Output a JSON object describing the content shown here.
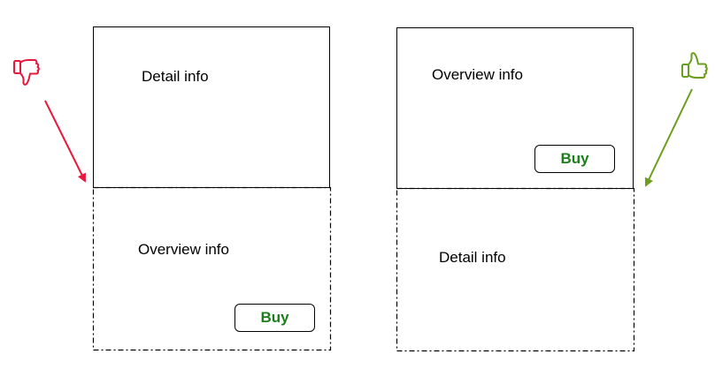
{
  "left_layout": {
    "top_label": "Detail info",
    "bottom_label": "Overview info",
    "buy_label": "Buy"
  },
  "right_layout": {
    "top_label": "Overview info",
    "bottom_label": "Detail info",
    "buy_label": "Buy"
  },
  "colors": {
    "bad": "#e8173c",
    "good": "#6b9e1c",
    "buy_text": "#1a7f1a"
  },
  "icons": {
    "left": "thumbs-down-icon",
    "right": "thumbs-up-icon"
  }
}
